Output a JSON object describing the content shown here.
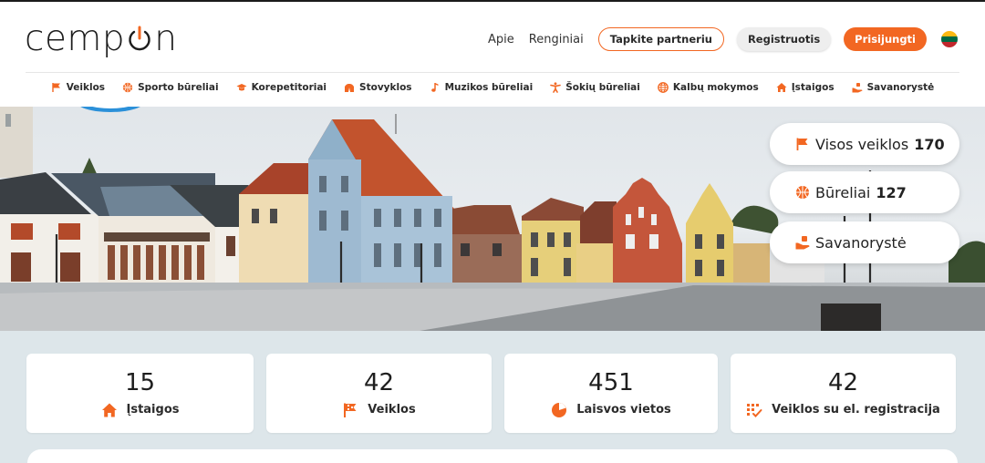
{
  "brand": {
    "logo_left": "cemp",
    "logo_right": "n",
    "accent": "#f26722"
  },
  "topnav": {
    "about": "Apie",
    "events": "Renginiai",
    "partner_button": "Tapkite partneriu",
    "register_button": "Registruotis",
    "login_button": "Prisijungti",
    "language_flag": "lithuania-flag"
  },
  "categories": [
    {
      "label": "Veiklos",
      "icon": "flag-icon"
    },
    {
      "label": "Sporto būreliai",
      "icon": "basketball-icon"
    },
    {
      "label": "Korepetitoriai",
      "icon": "graduation-cap-icon"
    },
    {
      "label": "Stovyklos",
      "icon": "tent-icon"
    },
    {
      "label": "Muzikos būreliai",
      "icon": "music-note-icon"
    },
    {
      "label": "Šokių būreliai",
      "icon": "dancer-icon"
    },
    {
      "label": "Kalbų mokymos",
      "icon": "globe-icon"
    },
    {
      "label": "Įstaigos",
      "icon": "home-icon"
    },
    {
      "label": "Savanorystė",
      "icon": "helping-hand-icon"
    }
  ],
  "hero_links": [
    {
      "label": "Visos veiklos",
      "count": "170",
      "icon": "flag-icon"
    },
    {
      "label": "Būreliai",
      "count": "127",
      "icon": "basketball-icon"
    },
    {
      "label": "Savanorystė",
      "count": "",
      "icon": "helping-hand-icon"
    }
  ],
  "stats": [
    {
      "value": "15",
      "label": "Įstaigos",
      "icon": "home-icon"
    },
    {
      "value": "42",
      "label": "Veiklos",
      "icon": "flag-icon"
    },
    {
      "value": "451",
      "label": "Laisvos vietos",
      "icon": "pie-chart-icon"
    },
    {
      "value": "42",
      "label": "Veiklos su el. registracija",
      "icon": "checklist-icon"
    }
  ]
}
